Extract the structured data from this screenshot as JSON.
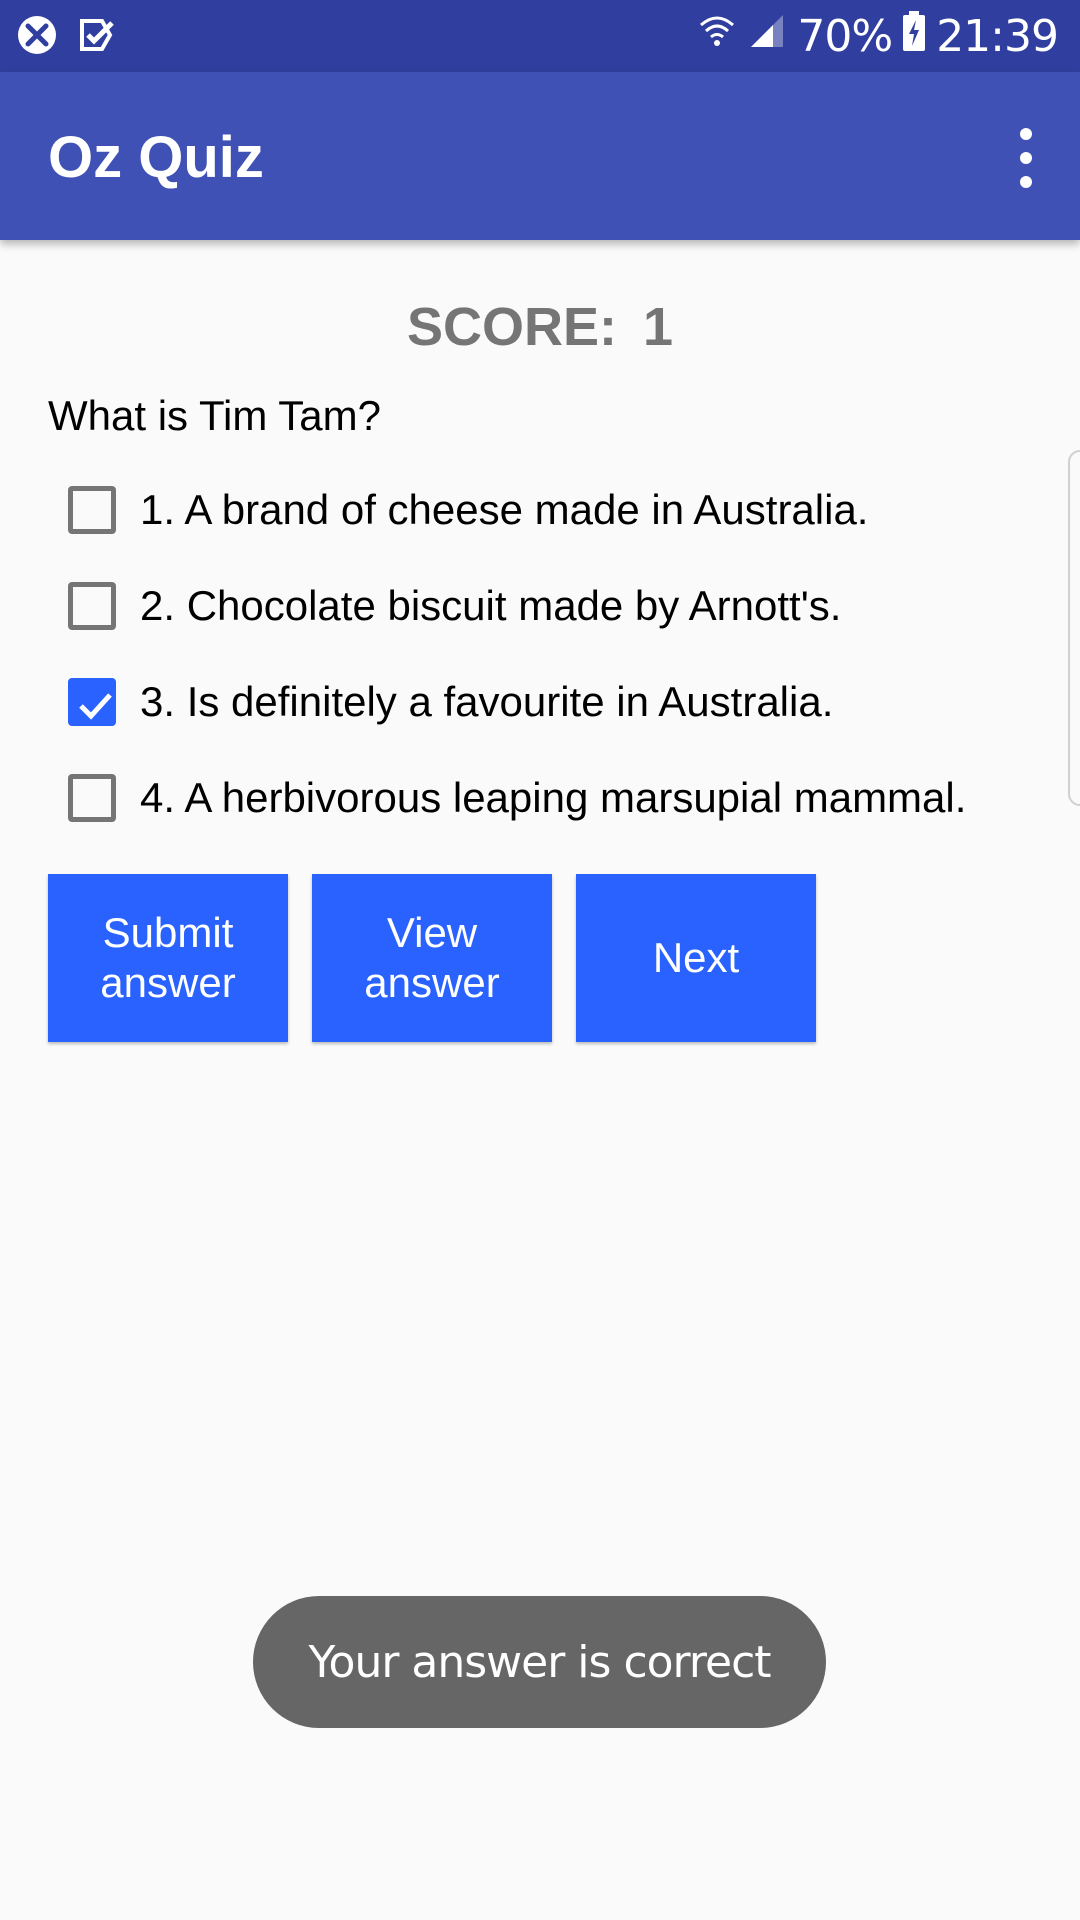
{
  "status_bar": {
    "battery": "70%",
    "time": "21:39",
    "icons": [
      "app-notification-icon",
      "checkmark-notification-icon",
      "wifi-icon",
      "signal-icon",
      "battery-charging-icon"
    ]
  },
  "app_bar": {
    "title": "Oz Quiz",
    "menu_icon": "overflow-menu-icon"
  },
  "score": {
    "label": "SCORE:",
    "value": "1"
  },
  "question": "What is Tim Tam?",
  "options": [
    {
      "label": "1. A brand of cheese made in Australia.",
      "checked": false
    },
    {
      "label": "2. Chocolate biscuit made by Arnott's.",
      "checked": false
    },
    {
      "label": "3. Is definitely a favourite in Australia.",
      "checked": true
    },
    {
      "label": "4. A herbivorous leaping marsupial mammal.",
      "checked": false
    }
  ],
  "buttons": {
    "submit": "Submit\nanswer",
    "view": "View\nanswer",
    "next": "Next"
  },
  "toast": "Your answer is correct",
  "colors": {
    "status_bar": "#303f9f",
    "app_bar": "#3f51b5",
    "accent": "#2962ff",
    "toast": "#666666"
  }
}
